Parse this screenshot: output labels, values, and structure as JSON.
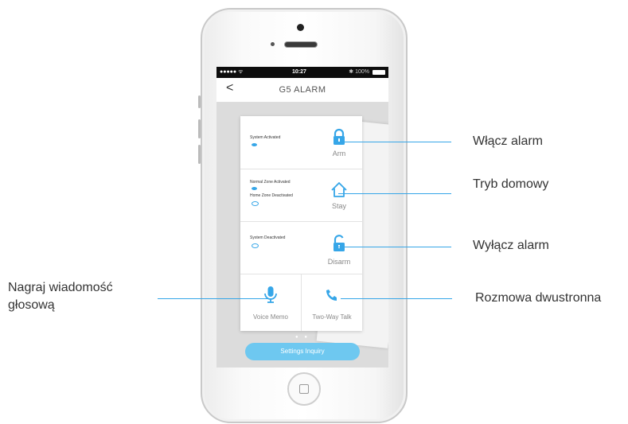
{
  "status_bar": {
    "signal": "●●●●● ᯤ",
    "time": "10:27",
    "battery": "✱ 100%"
  },
  "app": {
    "back_glyph": "<",
    "title": "G5 ALARM"
  },
  "rows": [
    {
      "status_lines": [
        "System Activated"
      ],
      "button_label": "Arm",
      "icon": "lock-closed-icon"
    },
    {
      "status_lines": [
        "Normal Zone Activated",
        "Home Zone Deactivated"
      ],
      "button_label": "Stay",
      "icon": "home-icon"
    },
    {
      "status_lines": [
        "System Deactivated"
      ],
      "button_label": "Disarm",
      "icon": "lock-open-icon"
    }
  ],
  "bottom": {
    "voice_memo_label": "Voice Memo",
    "two_way_talk_label": "Two-Way Talk"
  },
  "page_dots": "● ●",
  "settings_button": "Settings Inquiry",
  "callouts": {
    "arm": "Włącz alarm",
    "stay": "Tryb domowy",
    "disarm": "Wyłącz alarm",
    "voice_line1": "Nagraj wiadomość",
    "voice_line2": "głosową",
    "talk": "Rozmowa dwustronna"
  },
  "colors": {
    "accent": "#36a6e8",
    "button": "#6ec8f0"
  }
}
